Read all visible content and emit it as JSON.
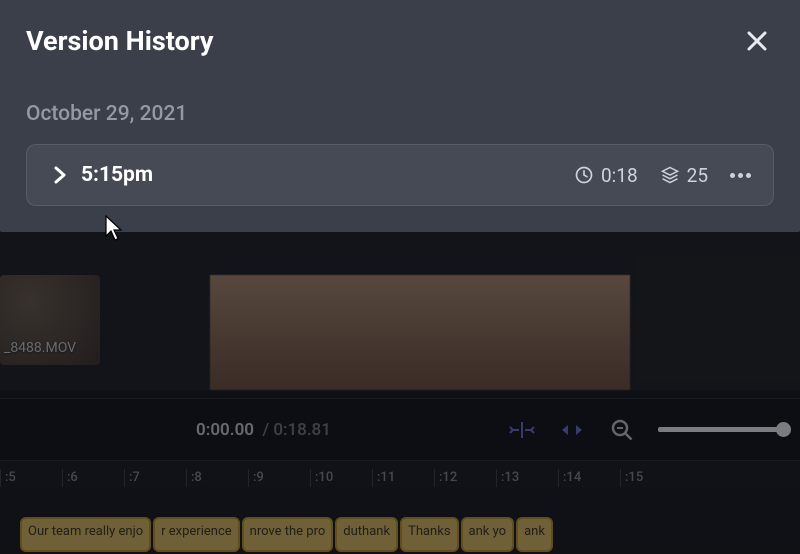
{
  "modal": {
    "title": "Version History",
    "date_header": "October 29, 2021",
    "version": {
      "time_label": "5:15pm",
      "duration": "0:18",
      "layer_count": "25"
    }
  },
  "editor": {
    "file_label": "_8488.MOV",
    "current_time": "0:00.00",
    "total_time": "0:18.81",
    "ruler_ticks": [
      ":5",
      ":6",
      ":7",
      ":8",
      ":9",
      ":10",
      ":11",
      ":12",
      ":13",
      ":14",
      ":15"
    ],
    "captions": [
      "Our team really enjo",
      "r experience",
      "nrove the pro",
      "duthank",
      "Thanks",
      "ank yo",
      "ank"
    ]
  }
}
